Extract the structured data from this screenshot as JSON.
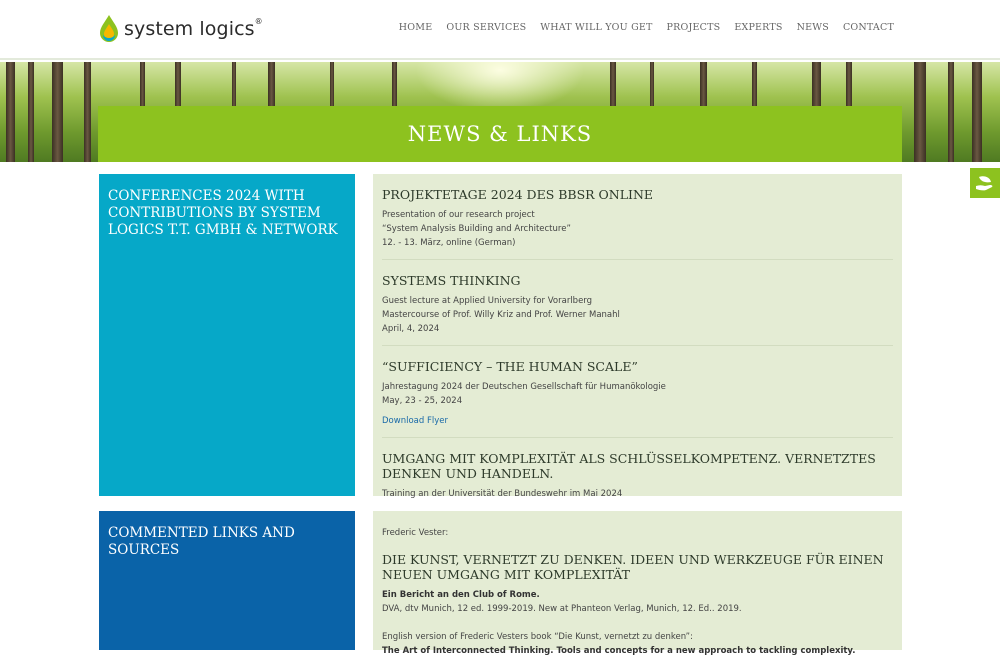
{
  "brand": {
    "name": "system logics",
    "registered": "®",
    "drop_colors": [
      "#8dc21f",
      "#f5b800",
      "#06a8c8"
    ]
  },
  "nav": [
    "HOME",
    "OUR SERVICES",
    "WHAT WILL YOU GET",
    "PROJECTS",
    "EXPERTS",
    "NEWS",
    "CONTACT"
  ],
  "hero": {
    "title": "NEWS & LINKS"
  },
  "side_tab": {
    "icon": "leaf-hand-icon"
  },
  "section1": {
    "title": "CONFERENCES 2024 WITH CONTRIBUTIONS BY SYSTEM LOGICS T.T. GMBH & NETWORK",
    "entries": [
      {
        "title": "PROJEKTETAGE 2024 DES BBSR ONLINE",
        "lines": [
          "Presentation of our research project",
          "“System Analysis Building and Architecture”",
          "12. - 13. März, online (German)"
        ]
      },
      {
        "title": "SYSTEMS THINKING",
        "lines": [
          "Guest lecture at Applied University for Vorarlberg",
          "Mastercourse of Prof. Willy Kriz and Prof. Werner Manahl",
          "April, 4, 2024"
        ]
      },
      {
        "title": "“SUFFICIENCY – THE HUMAN SCALE”",
        "lines": [
          "Jahrestagung 2024 der Deutschen Gesellschaft für Humanökologie",
          "May, 23 - 25, 2024"
        ],
        "link": "Download Flyer"
      },
      {
        "title": "UMGANG MIT KOMPLEXITÄT ALS SCHLÜSSELKOMPETENZ. VERNETZTES DENKEN UND HANDELN.",
        "lines": [
          "Training an der Universität der Bundeswehr im Mai 2024"
        ]
      }
    ]
  },
  "section2": {
    "title": "COMMENTED LINKS AND SOURCES",
    "author": "Frederic Vester:",
    "book_title": "DIE KUNST, VERNETZT ZU DENKEN. IDEEN UND WERKZEUGE FÜR EINEN NEUEN UMGANG MIT KOMPLEXITÄT",
    "subtitle": "Ein Bericht an den Club of Rome.",
    "edition": "DVA, dtv Munich, 12 ed. 1999-2019. New at Phanteon Verlag, Munich, 12. Ed.. 2019.",
    "english_intro": "English version of Frederic Vesters book “Die Kunst, vernetzt zu denken”:",
    "english_title": "The Art of Interconnected Thinking. Tools and concepts for a new approach to tackling complexity."
  }
}
